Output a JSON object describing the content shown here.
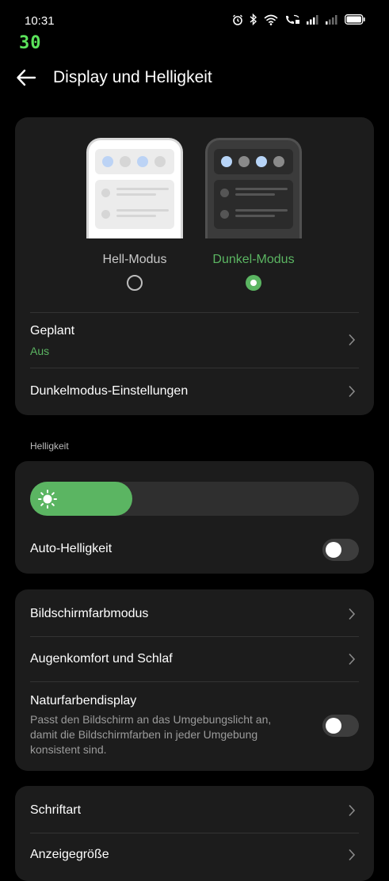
{
  "status_bar": {
    "time": "10:31",
    "icons": [
      "alarm-icon",
      "bluetooth-icon",
      "wifi-icon",
      "wifi-calling-icon",
      "signal-icon",
      "signal-icon",
      "battery-icon"
    ]
  },
  "fps_counter": "30",
  "header": {
    "back_icon": "arrow-left-icon",
    "title": "Display und Helligkeit"
  },
  "theme": {
    "options": [
      {
        "label": "Hell-Modus",
        "selected": false
      },
      {
        "label": "Dunkel-Modus",
        "selected": true
      }
    ],
    "scheduled": {
      "title": "Geplant",
      "value": "Aus"
    },
    "dark_settings": {
      "title": "Dunkelmodus-Einstellungen"
    }
  },
  "brightness": {
    "section_title": "Helligkeit",
    "level": 0.31,
    "auto_label": "Auto-Helligkeit",
    "auto_enabled": false
  },
  "display": {
    "color_mode": "Bildschirmfarbmodus",
    "eye_comfort": "Augenkomfort und Schlaf",
    "natural_color": {
      "title": "Naturfarbendisplay",
      "description": "Passt den Bildschirm an das Umgebungslicht an, damit die Bildschirmfarben in jeder Umgebung konsistent sind.",
      "enabled": false
    }
  },
  "text": {
    "font": "Schriftart",
    "display_size": "Anzeigegröße"
  },
  "colors": {
    "accent": "#5bb562",
    "background": "#000000",
    "card": "#1c1c1c"
  }
}
